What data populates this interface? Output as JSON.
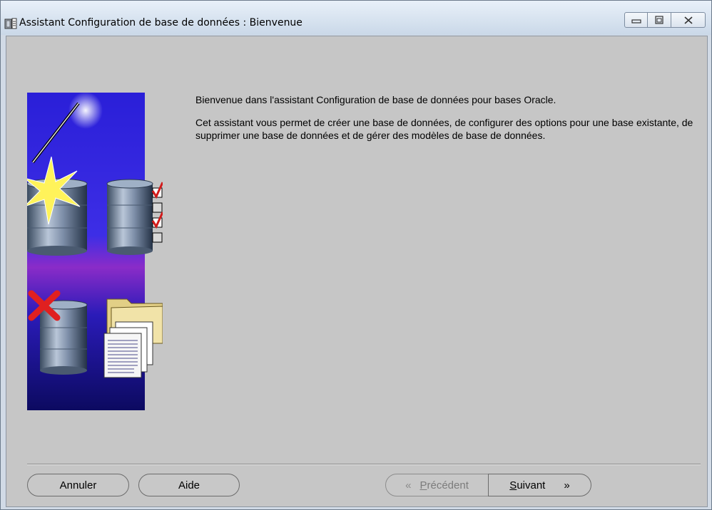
{
  "window": {
    "title": "Assistant Configuration de base de données : Bienvenue",
    "controls": [
      "minimize",
      "maximize",
      "close"
    ]
  },
  "content": {
    "welcome": "Bienvenue dans l'assistant Configuration de base de données pour bases Oracle.",
    "description": "Cet assistant vous permet de créer une base de données, de configurer des options pour une base existante, de supprimer une base de données et de gérer des modèles de base de données."
  },
  "buttons": {
    "cancel": "Annuler",
    "help": "Aide",
    "back_mnemonic": "P",
    "back_rest": "récédent",
    "back_arrow": "«",
    "next_mnemonic": "S",
    "next_rest": "uivant",
    "next_arrow": "»"
  }
}
